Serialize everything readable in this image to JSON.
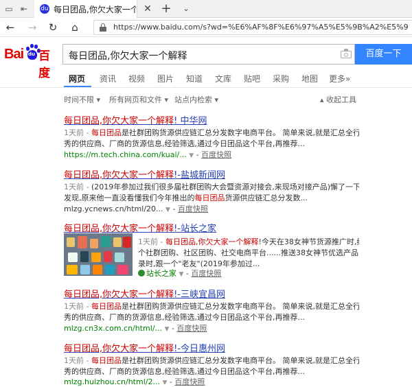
{
  "browser": {
    "tab_title": "每日团品,你欠大家一个!",
    "tab_favicon": "du",
    "url": "https://www.baidu.com/s?wd=%E6%AF%8F%E6%97%A5%E5%9B%A2%E5%93%81%2C%E4%BD%A0%E6%AC%A0%E5%A4%A7%E5%AE%B6"
  },
  "logo": {
    "bai": "Bai",
    "du": "du",
    "text": "百度"
  },
  "search": {
    "query": "每日团品,你欠大家一个解释",
    "button": "百度一下"
  },
  "tabs": [
    "网页",
    "资讯",
    "视频",
    "图片",
    "知道",
    "文库",
    "贴吧",
    "采购",
    "地图",
    "更多»"
  ],
  "filters": {
    "time": "时间不限 ▾",
    "files": "所有网页和文件 ▾",
    "site": "站点内检索 ▾",
    "collapse": "▴ 收起工具"
  },
  "results": [
    {
      "title_em": "每日团品,你欠大家一个解释",
      "title_rest": "! 中华网",
      "line1_date": "1天前 - ",
      "line1_em": "每日团品",
      "line1_rest": "是社群团购货源供应链汇总分发数字电商平台。 简单来说,就是汇总全行业优",
      "line2": "秀的供应商、厂商的货源信息,经验筛选,通过今日团品这个平台,再推荐...",
      "url": "https://m.tech.china.com/kuai/...",
      "snap": "百度快照"
    },
    {
      "title_em": "每日团品,你欠大家一个解释",
      "title_rest": "!-盐城新闻网",
      "line1_date": "1天前 - ",
      "line1_rest": "(2019年参加过我们很多届社群团购大会暨资源对接会,来现场对接产品)懈了一下天,才",
      "line2_a": "发现,原来他一直没看懂我们今年推出的",
      "line2_em": "每日团品",
      "line2_b": "货源供应链汇总分发数...",
      "url": "mlzg.ycnews.cn/html/20...",
      "snap": "百度快照"
    },
    {
      "title_em": "每日团品,你欠大家一个解释",
      "title_rest": "!-站长之家",
      "line1_date": "1天前 - ",
      "line1_em": "每日团品,你欠大家一个解释",
      "line1_rest": "!今天在38女神节货源推广时,给各",
      "line2": "个社群团购、社区团购、社交电商平台......推送38女神节优选产品目",
      "line3": "录时,跟一个\"老友\"(2019年参加过...",
      "site": "站长之家",
      "snap": "百度快照"
    },
    {
      "title_em": "每日团品,你欠大家一个解释",
      "title_rest": "!-三峡宜昌网",
      "line1_date": "1天前 - ",
      "line1_em": "每日团品",
      "line1_rest": "是社群团购货源供应链汇总分发数字电商平台。 简单来说,就是汇总全行业",
      "line2": "秀的供应商、厂商的货源信息,经验筛选,通过今日团品这个平台,再推荐...",
      "url": "mlzg.cn3x.com.cn/html/...",
      "snap": "百度快照"
    },
    {
      "title_em": "每日团品,你欠大家一个解释",
      "title_rest": "!-今日惠州网",
      "line1_date": "1天前 - ",
      "line1_em": "每日团品",
      "line1_rest": "是社群团购货源供应链汇总分发数字电商平台。 简单来说,就是汇总全行业优",
      "line2": "秀的供应商、厂商的货源信息,经验筛选,通过今日团品这个平台,再推荐...",
      "url": "mlzg.huizhou.cn/html/2...",
      "snap": "百度快照"
    }
  ]
}
